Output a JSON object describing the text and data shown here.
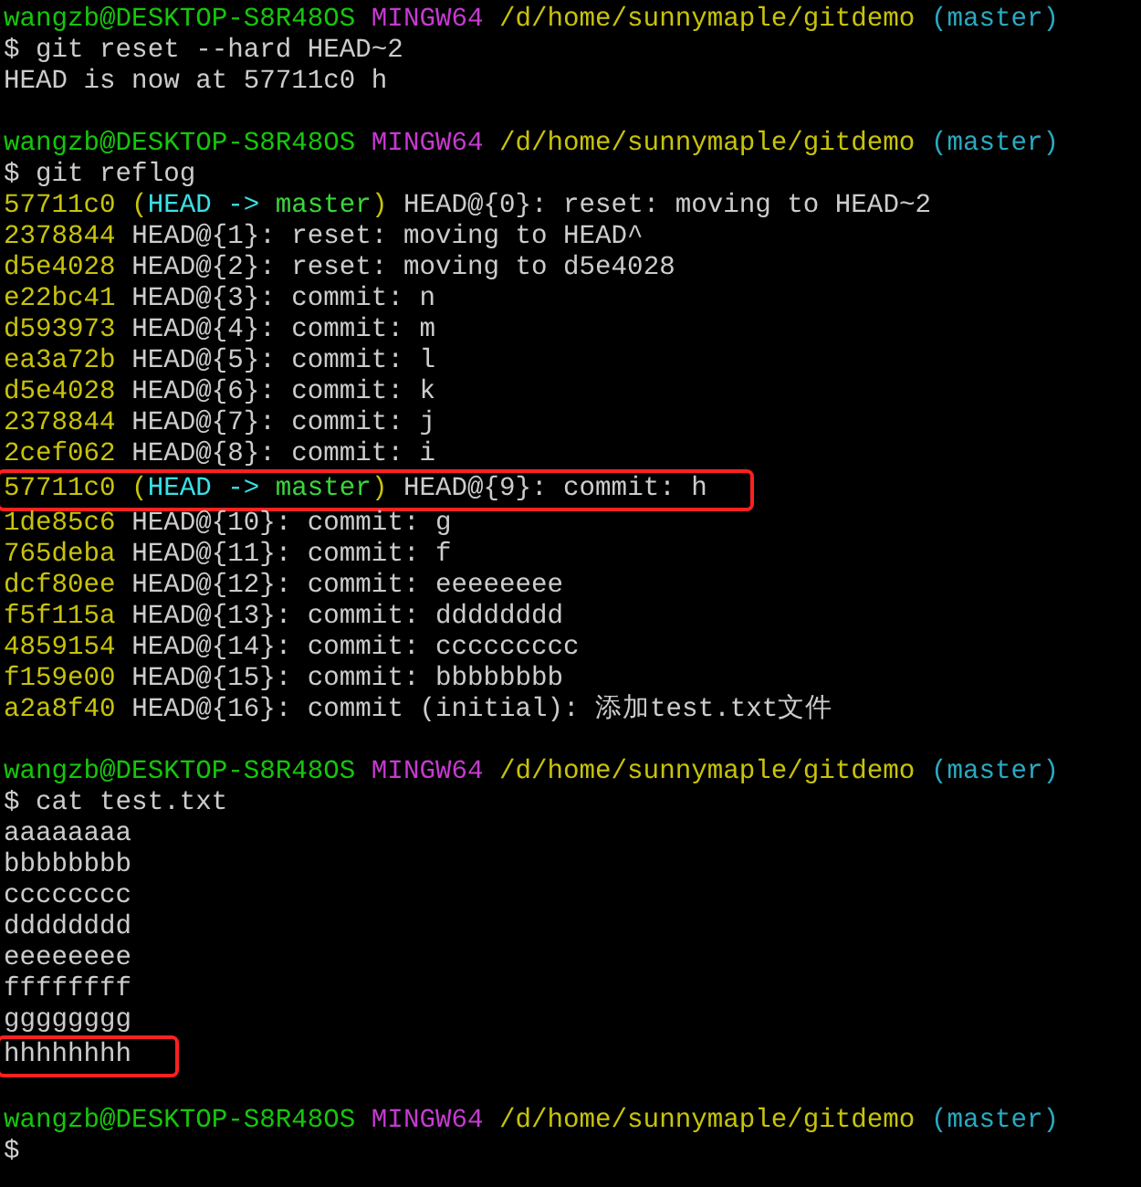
{
  "terminal": {
    "blocks": [
      {
        "lines": [
          {
            "spans": [
              {
                "text": "wangzb@DESKTOP-S8R48OS",
                "color": "#16c60c"
              },
              {
                "text": " MINGW64",
                "color": "#c73ad1"
              },
              {
                "text": " /d/home/sunnymaple/gitdemo",
                "color": "#c8c30c"
              },
              {
                "text": " (master)",
                "color": "#2aa9c1"
              }
            ],
            "highlighted": false
          },
          {
            "spans": [
              {
                "text": "$ git reset --hard HEAD~2",
                "color": "#cccccc"
              }
            ],
            "highlighted": false
          },
          {
            "spans": [
              {
                "text": "HEAD is now at 57711c0 h",
                "color": "#cccccc"
              }
            ],
            "highlighted": false
          }
        ]
      },
      {
        "lines": [
          {
            "spans": [
              {
                "text": "wangzb@DESKTOP-S8R48OS",
                "color": "#16c60c"
              },
              {
                "text": " MINGW64",
                "color": "#c73ad1"
              },
              {
                "text": " /d/home/sunnymaple/gitdemo",
                "color": "#c8c30c"
              },
              {
                "text": " (master)",
                "color": "#2aa9c1"
              }
            ],
            "highlighted": false
          },
          {
            "spans": [
              {
                "text": "$ git reflog",
                "color": "#cccccc"
              }
            ],
            "highlighted": false
          },
          {
            "spans": [
              {
                "text": "57711c0 (",
                "color": "#c8c30c"
              },
              {
                "text": "HEAD -> ",
                "color": "#3ae0e6"
              },
              {
                "text": "master",
                "color": "#3cd43c"
              },
              {
                "text": ")",
                "color": "#c8c30c"
              },
              {
                "text": " HEAD@{0}: reset: moving to HEAD~2",
                "color": "#cccccc"
              }
            ],
            "highlighted": false
          },
          {
            "spans": [
              {
                "text": "2378844",
                "color": "#c8c30c"
              },
              {
                "text": " HEAD@{1}: reset: moving to HEAD^",
                "color": "#cccccc"
              }
            ],
            "highlighted": false
          },
          {
            "spans": [
              {
                "text": "d5e4028",
                "color": "#c8c30c"
              },
              {
                "text": " HEAD@{2}: reset: moving to d5e4028",
                "color": "#cccccc"
              }
            ],
            "highlighted": false
          },
          {
            "spans": [
              {
                "text": "e22bc41",
                "color": "#c8c30c"
              },
              {
                "text": " HEAD@{3}: commit: n",
                "color": "#cccccc"
              }
            ],
            "highlighted": false
          },
          {
            "spans": [
              {
                "text": "d593973",
                "color": "#c8c30c"
              },
              {
                "text": " HEAD@{4}: commit: m",
                "color": "#cccccc"
              }
            ],
            "highlighted": false
          },
          {
            "spans": [
              {
                "text": "ea3a72b",
                "color": "#c8c30c"
              },
              {
                "text": " HEAD@{5}: commit: l",
                "color": "#cccccc"
              }
            ],
            "highlighted": false
          },
          {
            "spans": [
              {
                "text": "d5e4028",
                "color": "#c8c30c"
              },
              {
                "text": " HEAD@{6}: commit: k",
                "color": "#cccccc"
              }
            ],
            "highlighted": false
          },
          {
            "spans": [
              {
                "text": "2378844",
                "color": "#c8c30c"
              },
              {
                "text": " HEAD@{7}: commit: j",
                "color": "#cccccc"
              }
            ],
            "highlighted": false
          },
          {
            "spans": [
              {
                "text": "2cef062",
                "color": "#c8c30c"
              },
              {
                "text": " HEAD@{8}: commit: i",
                "color": "#cccccc"
              }
            ],
            "highlighted": false
          },
          {
            "spans": [
              {
                "text": "57711c0 (",
                "color": "#c8c30c"
              },
              {
                "text": "HEAD -> ",
                "color": "#3ae0e6"
              },
              {
                "text": "master",
                "color": "#3cd43c"
              },
              {
                "text": ")",
                "color": "#c8c30c"
              },
              {
                "text": " HEAD@{9}: commit: h",
                "color": "#cccccc"
              }
            ],
            "highlighted": true
          },
          {
            "spans": [
              {
                "text": "1de85c6",
                "color": "#c8c30c"
              },
              {
                "text": " HEAD@{10}: commit: g",
                "color": "#cccccc"
              }
            ],
            "highlighted": false
          },
          {
            "spans": [
              {
                "text": "765deba",
                "color": "#c8c30c"
              },
              {
                "text": " HEAD@{11}: commit: f",
                "color": "#cccccc"
              }
            ],
            "highlighted": false
          },
          {
            "spans": [
              {
                "text": "dcf80ee",
                "color": "#c8c30c"
              },
              {
                "text": " HEAD@{12}: commit: eeeeeeee",
                "color": "#cccccc"
              }
            ],
            "highlighted": false
          },
          {
            "spans": [
              {
                "text": "f5f115a",
                "color": "#c8c30c"
              },
              {
                "text": " HEAD@{13}: commit: dddddddd",
                "color": "#cccccc"
              }
            ],
            "highlighted": false
          },
          {
            "spans": [
              {
                "text": "4859154",
                "color": "#c8c30c"
              },
              {
                "text": " HEAD@{14}: commit: ccccccccc",
                "color": "#cccccc"
              }
            ],
            "highlighted": false
          },
          {
            "spans": [
              {
                "text": "f159e00",
                "color": "#c8c30c"
              },
              {
                "text": " HEAD@{15}: commit: bbbbbbbb",
                "color": "#cccccc"
              }
            ],
            "highlighted": false
          },
          {
            "spans": [
              {
                "text": "a2a8f40",
                "color": "#c8c30c"
              },
              {
                "text": " HEAD@{16}: commit (initial): 添加test.txt文件",
                "color": "#cccccc"
              }
            ],
            "highlighted": false
          }
        ]
      },
      {
        "lines": [
          {
            "spans": [
              {
                "text": "wangzb@DESKTOP-S8R48OS",
                "color": "#16c60c"
              },
              {
                "text": " MINGW64",
                "color": "#c73ad1"
              },
              {
                "text": " /d/home/sunnymaple/gitdemo",
                "color": "#c8c30c"
              },
              {
                "text": " (master)",
                "color": "#2aa9c1"
              }
            ],
            "highlighted": false
          },
          {
            "spans": [
              {
                "text": "$ cat test.txt",
                "color": "#cccccc"
              }
            ],
            "highlighted": false
          },
          {
            "spans": [
              {
                "text": "aaaaaaaa",
                "color": "#cccccc"
              }
            ],
            "highlighted": false
          },
          {
            "spans": [
              {
                "text": "bbbbbbbb",
                "color": "#cccccc"
              }
            ],
            "highlighted": false
          },
          {
            "spans": [
              {
                "text": "cccccccc",
                "color": "#cccccc"
              }
            ],
            "highlighted": false
          },
          {
            "spans": [
              {
                "text": "dddddddd",
                "color": "#cccccc"
              }
            ],
            "highlighted": false
          },
          {
            "spans": [
              {
                "text": "eeeeeeee",
                "color": "#cccccc"
              }
            ],
            "highlighted": false
          },
          {
            "spans": [
              {
                "text": "ffffffff",
                "color": "#cccccc"
              }
            ],
            "highlighted": false
          },
          {
            "spans": [
              {
                "text": "gggggggg",
                "color": "#cccccc"
              }
            ],
            "highlighted": false
          },
          {
            "spans": [
              {
                "text": "hhhhhhhh",
                "color": "#cccccc"
              }
            ],
            "highlighted": true
          }
        ]
      },
      {
        "lines": [
          {
            "spans": [
              {
                "text": "wangzb@DESKTOP-S8R48OS",
                "color": "#16c60c"
              },
              {
                "text": " MINGW64",
                "color": "#c73ad1"
              },
              {
                "text": " /d/home/sunnymaple/gitdemo",
                "color": "#c8c30c"
              },
              {
                "text": " (master)",
                "color": "#2aa9c1"
              }
            ],
            "highlighted": false
          },
          {
            "spans": [
              {
                "text": "$",
                "color": "#cccccc"
              }
            ],
            "highlighted": false
          }
        ]
      }
    ]
  }
}
